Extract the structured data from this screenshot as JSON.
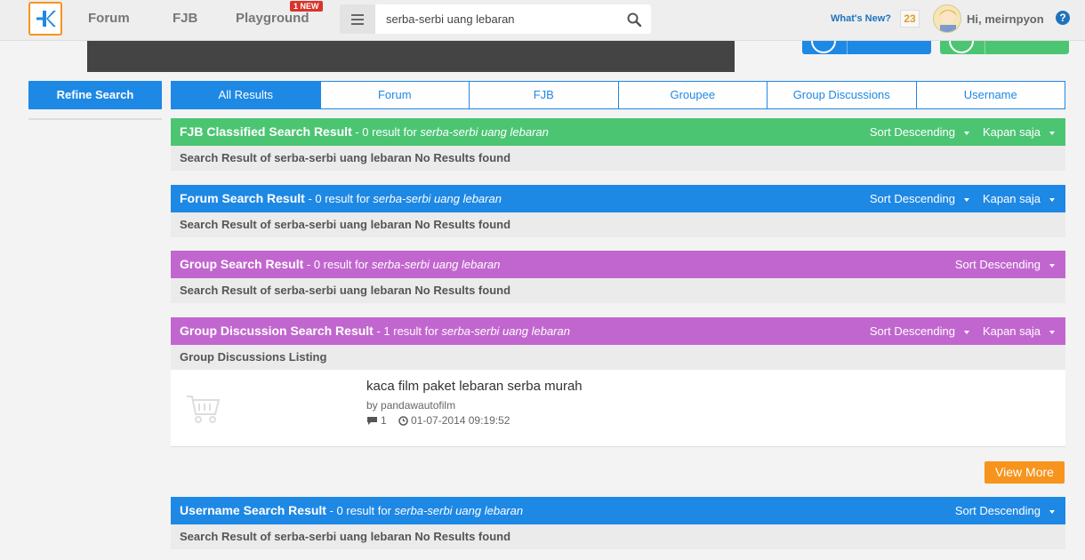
{
  "header": {
    "nav": [
      {
        "label": "Forum"
      },
      {
        "label": "FJB"
      },
      {
        "label": "Playground"
      }
    ],
    "new_badge": "1 NEW",
    "search_value": "serba-serbi uang lebaran",
    "whats_new": "What's New?",
    "notification_count": "23",
    "greeting": "Hi, meirnpyon",
    "help": "?"
  },
  "sidebar": {
    "refine_label": "Refine Search"
  },
  "tabs": [
    {
      "label": "All Results",
      "active": true
    },
    {
      "label": "Forum"
    },
    {
      "label": "FJB"
    },
    {
      "label": "Groupee"
    },
    {
      "label": "Group Discussions"
    },
    {
      "label": "Username"
    }
  ],
  "sections": [
    {
      "title": "FJB Classified Search Result",
      "count": " - 0 result for ",
      "query": "serba-serbi uang lebaran",
      "sort": "Sort Descending",
      "when": "Kapan saja",
      "body": "Search Result of serba-serbi uang lebaran No Results found",
      "color": "#4cc573"
    },
    {
      "title": "Forum Search Result",
      "count": " - 0 result for ",
      "query": "serba-serbi uang lebaran",
      "sort": "Sort Descending",
      "when": "Kapan saja",
      "body": "Search Result of serba-serbi uang lebaran No Results found",
      "color": "#1e88e5"
    },
    {
      "title": "Group Search Result",
      "count": " - 0 result for ",
      "query": "serba-serbi uang lebaran",
      "sort": "Sort Descending",
      "body": "Search Result of serba-serbi uang lebaran No Results found",
      "color": "#c266cf"
    },
    {
      "title": "Group Discussion Search Result",
      "count": " - 1 result for ",
      "query": "serba-serbi uang lebaran",
      "sort": "Sort Descending",
      "when": "Kapan saja",
      "body": "Group Discussions Listing",
      "color": "#c266cf"
    },
    {
      "title": "Username Search Result",
      "count": " - 0 result for ",
      "query": "serba-serbi uang lebaran",
      "sort": "Sort Descending",
      "body": "Search Result of serba-serbi uang lebaran No Results found",
      "color": "#1e88e5"
    }
  ],
  "discussion_item": {
    "title": "kaca film paket lebaran serba murah",
    "by_prefix": "by ",
    "author": "pandawautofilm",
    "replies": "1",
    "datetime": "01-07-2014 09:19:52"
  },
  "view_more": "View More",
  "icons": {
    "search": "search-icon",
    "menu": "hamburger-menu-icon",
    "comment": "comment-icon",
    "clock": "clock-icon",
    "cart": "shopping-cart-icon"
  }
}
